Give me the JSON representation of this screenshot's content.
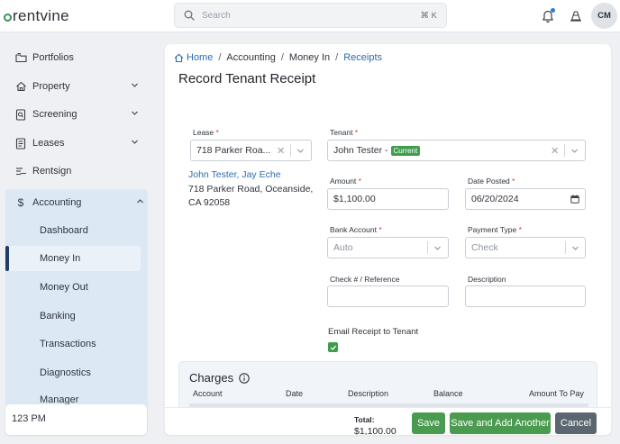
{
  "app": {
    "logo_text": "rentvine",
    "brand_color": "#3f8f5b",
    "accent_color": "#2b6cb0",
    "success_color": "#4a9a4f"
  },
  "header": {
    "search_placeholder": "Search",
    "search_shortcut": "⌘ K",
    "avatar_initials": "CM",
    "icons": [
      "search-icon",
      "bell-icon",
      "traffic-cone-icon"
    ]
  },
  "sidebar": {
    "items": [
      {
        "label": "Portfolios",
        "icon": "folders-icon",
        "expandable": false
      },
      {
        "label": "Property",
        "icon": "house-icon",
        "expandable": true
      },
      {
        "label": "Screening",
        "icon": "screening-icon",
        "expandable": true
      },
      {
        "label": "Leases",
        "icon": "lease-icon",
        "expandable": true
      },
      {
        "label": "Rentsign",
        "icon": "signature-icon",
        "expandable": false
      },
      {
        "label": "Accounting",
        "icon": "dollar-icon",
        "expandable": true,
        "expanded": true
      }
    ],
    "accounting_sub": [
      {
        "label": "Dashboard"
      },
      {
        "label": "Money In",
        "active": true
      },
      {
        "label": "Money Out"
      },
      {
        "label": "Banking"
      },
      {
        "label": "Transactions"
      },
      {
        "label": "Diagnostics"
      },
      {
        "label": "Manager"
      }
    ],
    "company": "123 PM"
  },
  "breadcrumb": {
    "home": "Home",
    "accounting": "Accounting",
    "money_in": "Money In",
    "receipts": "Receipts",
    "separator": "/"
  },
  "page": {
    "title": "Record Tenant Receipt"
  },
  "form": {
    "required_mark": "*",
    "lease": {
      "label": "Lease",
      "value": "718 Parker Roa..."
    },
    "tenant": {
      "label": "Tenant",
      "value": "John Tester -",
      "status": "Current"
    },
    "tenant_link": "John Tester, Jay Eche",
    "address_line1": "718 Parker Road, Oceanside,",
    "address_line2": "CA 92058",
    "amount": {
      "label": "Amount",
      "value": "$1,100.00"
    },
    "date_posted": {
      "label": "Date Posted",
      "value": "06/20/2024"
    },
    "bank_account": {
      "label": "Bank Account",
      "value": "Auto"
    },
    "payment_type": {
      "label": "Payment Type",
      "value": "Check"
    },
    "check_ref": {
      "label": "Check # / Reference",
      "value": ""
    },
    "description": {
      "label": "Description",
      "value": ""
    },
    "email_receipt": {
      "label": "Email Receipt to Tenant",
      "checked": true
    }
  },
  "charges": {
    "title": "Charges",
    "columns": [
      "Account",
      "Date",
      "Description",
      "Balance",
      "Amount To Pay"
    ]
  },
  "footer": {
    "total_label": "Total:",
    "total_value": "$1,100.00",
    "save": "Save",
    "save_add": "Save and Add Another",
    "cancel": "Cancel"
  }
}
